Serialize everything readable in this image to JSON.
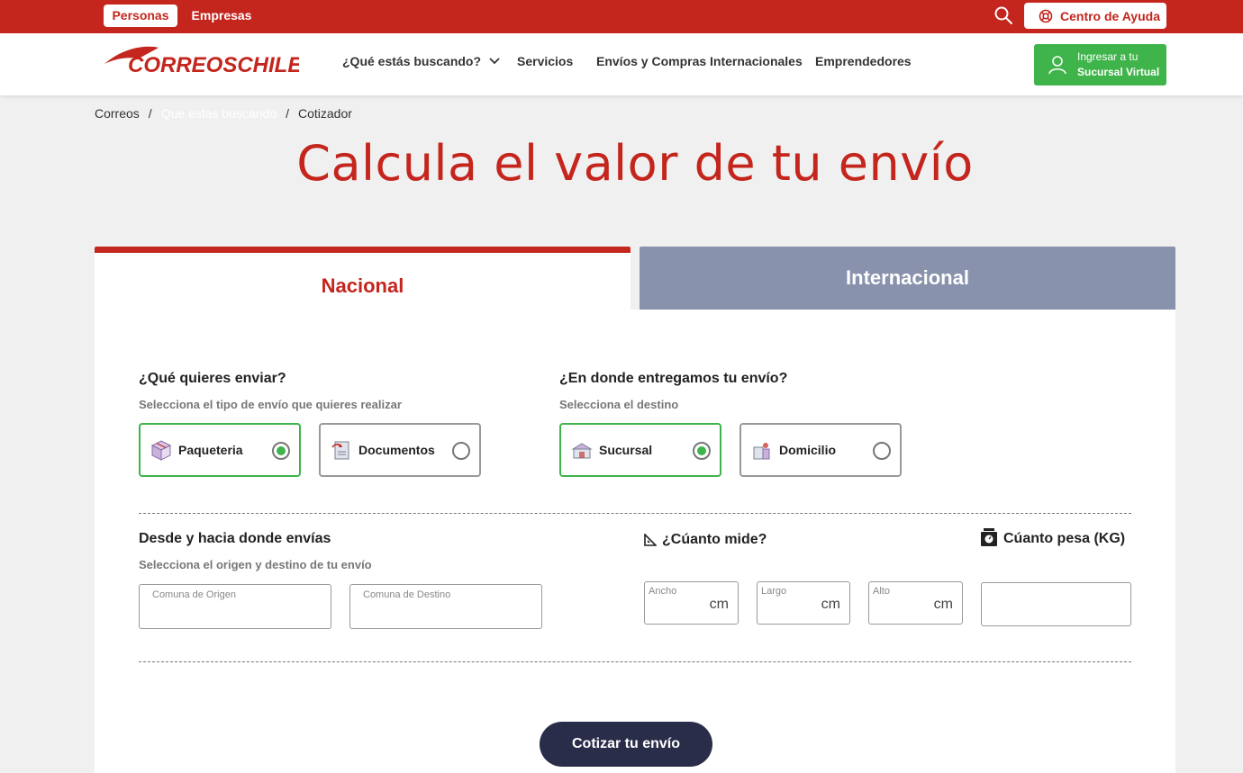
{
  "topbar": {
    "segments": [
      "Personas",
      "Empresas"
    ],
    "help_label": "Centro de Ayuda"
  },
  "header": {
    "logo_text": "CORREOSCHILE",
    "nav": [
      "¿Qué estás buscando?",
      "Servicios",
      "Envíos y Compras Internacionales",
      "Emprendedores"
    ],
    "sucursal_line1": "Ingresar a tu",
    "sucursal_line2": "Sucursal Virtual"
  },
  "breadcrumb": {
    "items": [
      "Correos",
      "Que estas buscando",
      "Cotizador"
    ],
    "separator": "/"
  },
  "page_title": "Calcula el valor de tu envío",
  "tabs": {
    "nacional": "Nacional",
    "internacional": "Internacional"
  },
  "que_enviar": {
    "title": "¿Qué quieres enviar?",
    "subtitle": "Selecciona el tipo de envío que quieres realizar",
    "options": [
      "Paqueteria",
      "Documentos"
    ],
    "selected": "Paqueteria"
  },
  "entrega": {
    "title": "¿En donde entregamos tu envío?",
    "subtitle": "Selecciona el destino",
    "options": [
      "Sucursal",
      "Domicilio"
    ],
    "selected": "Sucursal"
  },
  "ruta": {
    "title": "Desde y hacia donde envías",
    "subtitle": "Selecciona el origen y destino de tu envío",
    "origen_label": "Comuna de Origen",
    "destino_label": "Comuna de Destino"
  },
  "medidas": {
    "title": "¿Cúanto mide?",
    "ancho": "Ancho",
    "largo": "Largo",
    "alto": "Alto",
    "unit": "cm"
  },
  "peso": {
    "title": "Cúanto pesa (KG)"
  },
  "cta": "Cotizar tu envío",
  "colors": {
    "brand_red": "#c4251d",
    "green": "#3fb44a",
    "tab_inactive": "#8892ad",
    "cta": "#2a2d4a"
  }
}
